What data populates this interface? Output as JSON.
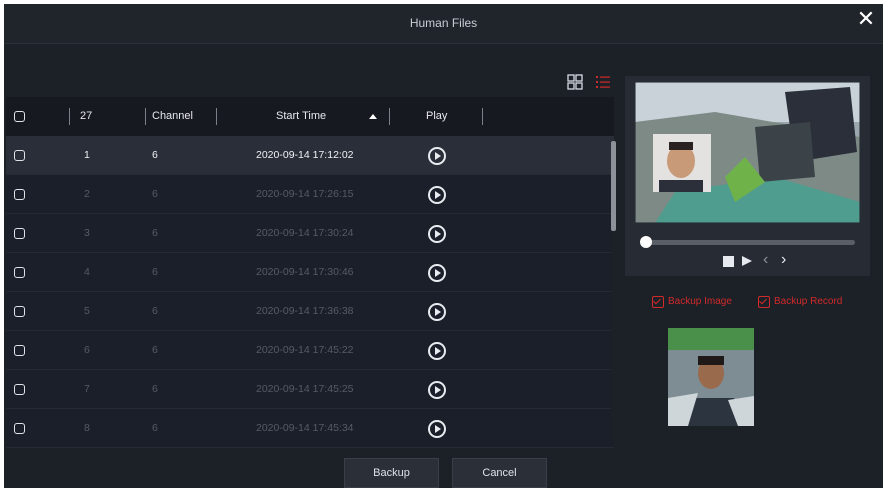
{
  "window": {
    "title": "Human Files",
    "close_icon": "close-icon"
  },
  "toolbar": {
    "grid_view_icon": "grid-view-icon",
    "list_view_icon": "list-view-icon",
    "accent": "#d12a2a"
  },
  "table": {
    "headers": {
      "count": "27",
      "channel": "Channel",
      "start_time": "Start Time",
      "play": "Play"
    },
    "sort_icon": "sort-ascending-icon",
    "rows": [
      {
        "no": "1",
        "channel": "6",
        "start_time": "2020-09-14 17:12:02",
        "selected": true
      },
      {
        "no": "2",
        "channel": "6",
        "start_time": "2020-09-14 17:26:15",
        "selected": false
      },
      {
        "no": "3",
        "channel": "6",
        "start_time": "2020-09-14 17:30:24",
        "selected": false
      },
      {
        "no": "4",
        "channel": "6",
        "start_time": "2020-09-14 17:30:46",
        "selected": false
      },
      {
        "no": "5",
        "channel": "6",
        "start_time": "2020-09-14 17:36:38",
        "selected": false
      },
      {
        "no": "6",
        "channel": "6",
        "start_time": "2020-09-14 17:45:22",
        "selected": false
      },
      {
        "no": "7",
        "channel": "6",
        "start_time": "2020-09-14 17:45:25",
        "selected": false
      },
      {
        "no": "8",
        "channel": "6",
        "start_time": "2020-09-14 17:45:34",
        "selected": false
      }
    ]
  },
  "preview": {
    "playback_progress": 0,
    "controls": [
      "stop-icon",
      "play-icon",
      "prev-icon",
      "next-icon"
    ]
  },
  "backup_options": {
    "image_label": "Backup Image",
    "record_label": "Backup Record",
    "image_checked": true,
    "record_checked": true
  },
  "footer": {
    "backup_label": "Backup",
    "cancel_label": "Cancel"
  }
}
